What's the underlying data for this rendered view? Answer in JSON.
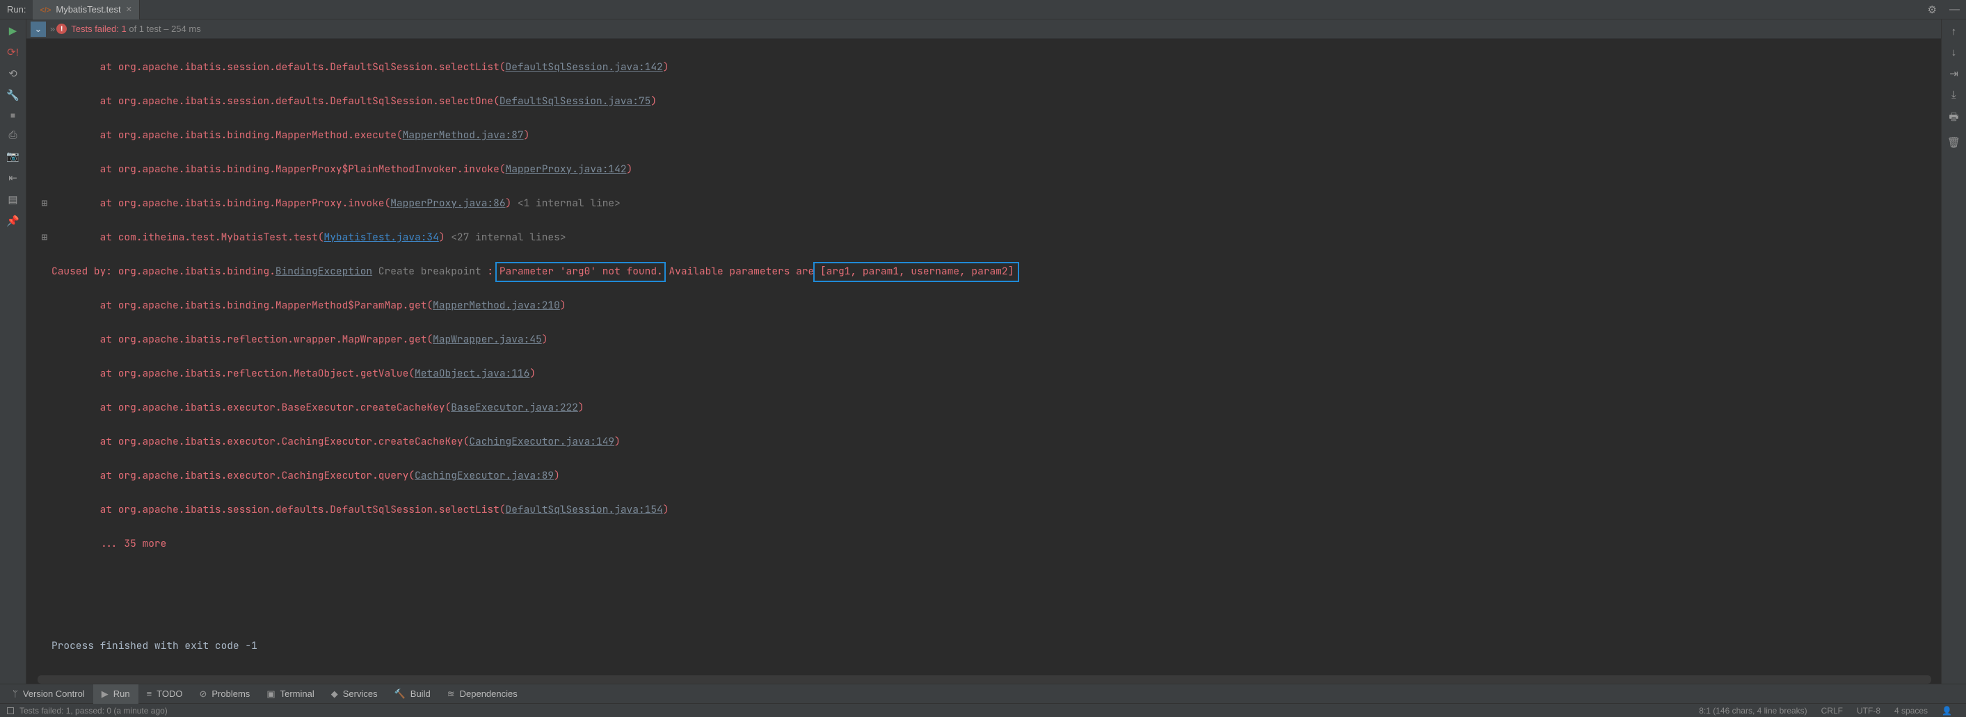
{
  "topbar": {
    "run_label": "Run:",
    "tab": {
      "name": "MybatisTest.test"
    }
  },
  "status": {
    "dbl_chevron": "»",
    "label_a": "Tests failed: ",
    "failed_count": "1",
    "label_b": " of 1 test",
    "duration": " – 254 ms"
  },
  "stack": [
    {
      "indent": "        ",
      "pre": "at org.apache.ibatis.session.defaults.DefaultSqlSession.selectList(",
      "link": "DefaultSqlSession.java:142",
      "lclass": "link2",
      "post": ")"
    },
    {
      "indent": "        ",
      "pre": "at org.apache.ibatis.session.defaults.DefaultSqlSession.selectOne(",
      "link": "DefaultSqlSession.java:75",
      "lclass": "link2",
      "post": ")"
    },
    {
      "indent": "        ",
      "pre": "at org.apache.ibatis.binding.MapperMethod.execute(",
      "link": "MapperMethod.java:87",
      "lclass": "link2",
      "post": ")"
    },
    {
      "indent": "        ",
      "pre": "at org.apache.ibatis.binding.MapperProxy$PlainMethodInvoker.invoke(",
      "link": "MapperProxy.java:142",
      "lclass": "link2",
      "post": ")"
    },
    {
      "indent": "        ",
      "exp": "⊞",
      "pre": "at org.apache.ibatis.binding.MapperProxy.invoke(",
      "link": "MapperProxy.java:86",
      "lclass": "link2",
      "post": ")",
      "tail": " <1 internal line>"
    },
    {
      "indent": "        ",
      "exp": "⊞",
      "pre": "at com.itheima.test.MybatisTest.test(",
      "link": "MybatisTest.java:34",
      "lclass": "bluehl",
      "post": ")",
      "tail": " <27 internal lines>"
    }
  ],
  "caused": {
    "pre": "Caused by: org.apache.ibatis.binding.",
    "exc": "BindingException",
    "bp": " Create breakpoint ",
    "colon": ": ",
    "msg1": "Parameter 'arg0' not found.",
    "mid": " Available parameters are ",
    "msg2": "[arg1, param1, username, param2]"
  },
  "stack2": [
    {
      "pre": "at org.apache.ibatis.binding.MapperMethod$ParamMap.get(",
      "link": "MapperMethod.java:210",
      "post": ")"
    },
    {
      "pre": "at org.apache.ibatis.reflection.wrapper.MapWrapper.get(",
      "link": "MapWrapper.java:45",
      "post": ")"
    },
    {
      "pre": "at org.apache.ibatis.reflection.MetaObject.getValue(",
      "link": "MetaObject.java:116",
      "post": ")"
    },
    {
      "pre": "at org.apache.ibatis.executor.BaseExecutor.createCacheKey(",
      "link": "BaseExecutor.java:222",
      "post": ")"
    },
    {
      "pre": "at org.apache.ibatis.executor.CachingExecutor.createCacheKey(",
      "link": "CachingExecutor.java:149",
      "post": ")"
    },
    {
      "pre": "at org.apache.ibatis.executor.CachingExecutor.query(",
      "link": "CachingExecutor.java:89",
      "post": ")"
    },
    {
      "pre": "at org.apache.ibatis.session.defaults.DefaultSqlSession.selectList(",
      "link": "DefaultSqlSession.java:154",
      "post": ")"
    }
  ],
  "more": "        ... 35 more",
  "exit": "Process finished with exit code -1",
  "bottom_tabs": {
    "vcs": "Version Control",
    "run": "Run",
    "todo": "TODO",
    "problems": "Problems",
    "terminal": "Terminal",
    "services": "Services",
    "build": "Build",
    "deps": "Dependencies"
  },
  "statusbar": {
    "left": "Tests failed: 1, passed: 0 (a minute ago)",
    "pos": "8:1 (146 chars, 4 line breaks)",
    "le": "CRLF",
    "enc": "UTF-8",
    "indent": "4 spaces"
  }
}
